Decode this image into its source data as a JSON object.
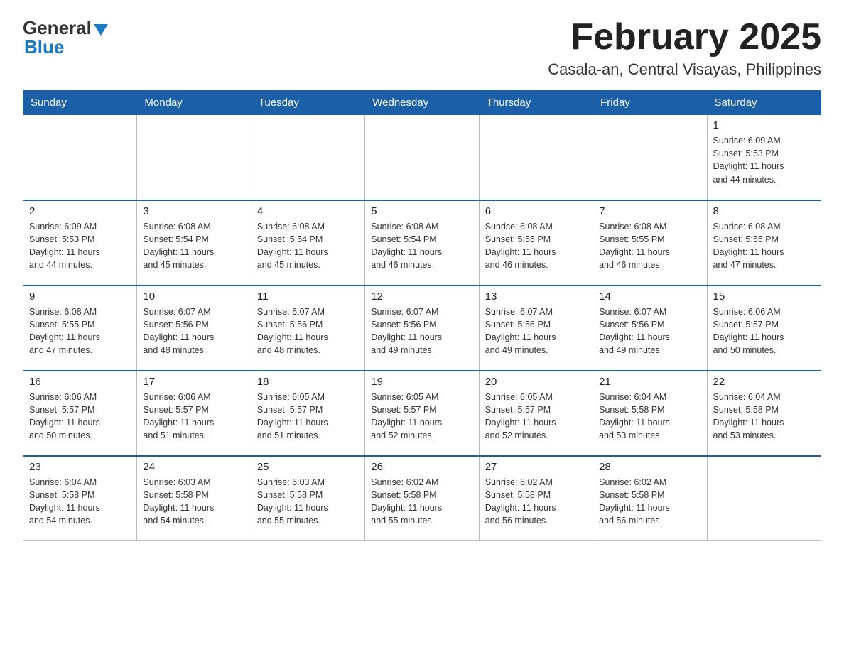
{
  "header": {
    "logo_general": "General",
    "logo_blue": "Blue",
    "month_title": "February 2025",
    "location": "Casala-an, Central Visayas, Philippines"
  },
  "weekdays": [
    "Sunday",
    "Monday",
    "Tuesday",
    "Wednesday",
    "Thursday",
    "Friday",
    "Saturday"
  ],
  "weeks": [
    [
      {
        "day": "",
        "info": ""
      },
      {
        "day": "",
        "info": ""
      },
      {
        "day": "",
        "info": ""
      },
      {
        "day": "",
        "info": ""
      },
      {
        "day": "",
        "info": ""
      },
      {
        "day": "",
        "info": ""
      },
      {
        "day": "1",
        "info": "Sunrise: 6:09 AM\nSunset: 5:53 PM\nDaylight: 11 hours\nand 44 minutes."
      }
    ],
    [
      {
        "day": "2",
        "info": "Sunrise: 6:09 AM\nSunset: 5:53 PM\nDaylight: 11 hours\nand 44 minutes."
      },
      {
        "day": "3",
        "info": "Sunrise: 6:08 AM\nSunset: 5:54 PM\nDaylight: 11 hours\nand 45 minutes."
      },
      {
        "day": "4",
        "info": "Sunrise: 6:08 AM\nSunset: 5:54 PM\nDaylight: 11 hours\nand 45 minutes."
      },
      {
        "day": "5",
        "info": "Sunrise: 6:08 AM\nSunset: 5:54 PM\nDaylight: 11 hours\nand 46 minutes."
      },
      {
        "day": "6",
        "info": "Sunrise: 6:08 AM\nSunset: 5:55 PM\nDaylight: 11 hours\nand 46 minutes."
      },
      {
        "day": "7",
        "info": "Sunrise: 6:08 AM\nSunset: 5:55 PM\nDaylight: 11 hours\nand 46 minutes."
      },
      {
        "day": "8",
        "info": "Sunrise: 6:08 AM\nSunset: 5:55 PM\nDaylight: 11 hours\nand 47 minutes."
      }
    ],
    [
      {
        "day": "9",
        "info": "Sunrise: 6:08 AM\nSunset: 5:55 PM\nDaylight: 11 hours\nand 47 minutes."
      },
      {
        "day": "10",
        "info": "Sunrise: 6:07 AM\nSunset: 5:56 PM\nDaylight: 11 hours\nand 48 minutes."
      },
      {
        "day": "11",
        "info": "Sunrise: 6:07 AM\nSunset: 5:56 PM\nDaylight: 11 hours\nand 48 minutes."
      },
      {
        "day": "12",
        "info": "Sunrise: 6:07 AM\nSunset: 5:56 PM\nDaylight: 11 hours\nand 49 minutes."
      },
      {
        "day": "13",
        "info": "Sunrise: 6:07 AM\nSunset: 5:56 PM\nDaylight: 11 hours\nand 49 minutes."
      },
      {
        "day": "14",
        "info": "Sunrise: 6:07 AM\nSunset: 5:56 PM\nDaylight: 11 hours\nand 49 minutes."
      },
      {
        "day": "15",
        "info": "Sunrise: 6:06 AM\nSunset: 5:57 PM\nDaylight: 11 hours\nand 50 minutes."
      }
    ],
    [
      {
        "day": "16",
        "info": "Sunrise: 6:06 AM\nSunset: 5:57 PM\nDaylight: 11 hours\nand 50 minutes."
      },
      {
        "day": "17",
        "info": "Sunrise: 6:06 AM\nSunset: 5:57 PM\nDaylight: 11 hours\nand 51 minutes."
      },
      {
        "day": "18",
        "info": "Sunrise: 6:05 AM\nSunset: 5:57 PM\nDaylight: 11 hours\nand 51 minutes."
      },
      {
        "day": "19",
        "info": "Sunrise: 6:05 AM\nSunset: 5:57 PM\nDaylight: 11 hours\nand 52 minutes."
      },
      {
        "day": "20",
        "info": "Sunrise: 6:05 AM\nSunset: 5:57 PM\nDaylight: 11 hours\nand 52 minutes."
      },
      {
        "day": "21",
        "info": "Sunrise: 6:04 AM\nSunset: 5:58 PM\nDaylight: 11 hours\nand 53 minutes."
      },
      {
        "day": "22",
        "info": "Sunrise: 6:04 AM\nSunset: 5:58 PM\nDaylight: 11 hours\nand 53 minutes."
      }
    ],
    [
      {
        "day": "23",
        "info": "Sunrise: 6:04 AM\nSunset: 5:58 PM\nDaylight: 11 hours\nand 54 minutes."
      },
      {
        "day": "24",
        "info": "Sunrise: 6:03 AM\nSunset: 5:58 PM\nDaylight: 11 hours\nand 54 minutes."
      },
      {
        "day": "25",
        "info": "Sunrise: 6:03 AM\nSunset: 5:58 PM\nDaylight: 11 hours\nand 55 minutes."
      },
      {
        "day": "26",
        "info": "Sunrise: 6:02 AM\nSunset: 5:58 PM\nDaylight: 11 hours\nand 55 minutes."
      },
      {
        "day": "27",
        "info": "Sunrise: 6:02 AM\nSunset: 5:58 PM\nDaylight: 11 hours\nand 56 minutes."
      },
      {
        "day": "28",
        "info": "Sunrise: 6:02 AM\nSunset: 5:58 PM\nDaylight: 11 hours\nand 56 minutes."
      },
      {
        "day": "",
        "info": ""
      }
    ]
  ]
}
